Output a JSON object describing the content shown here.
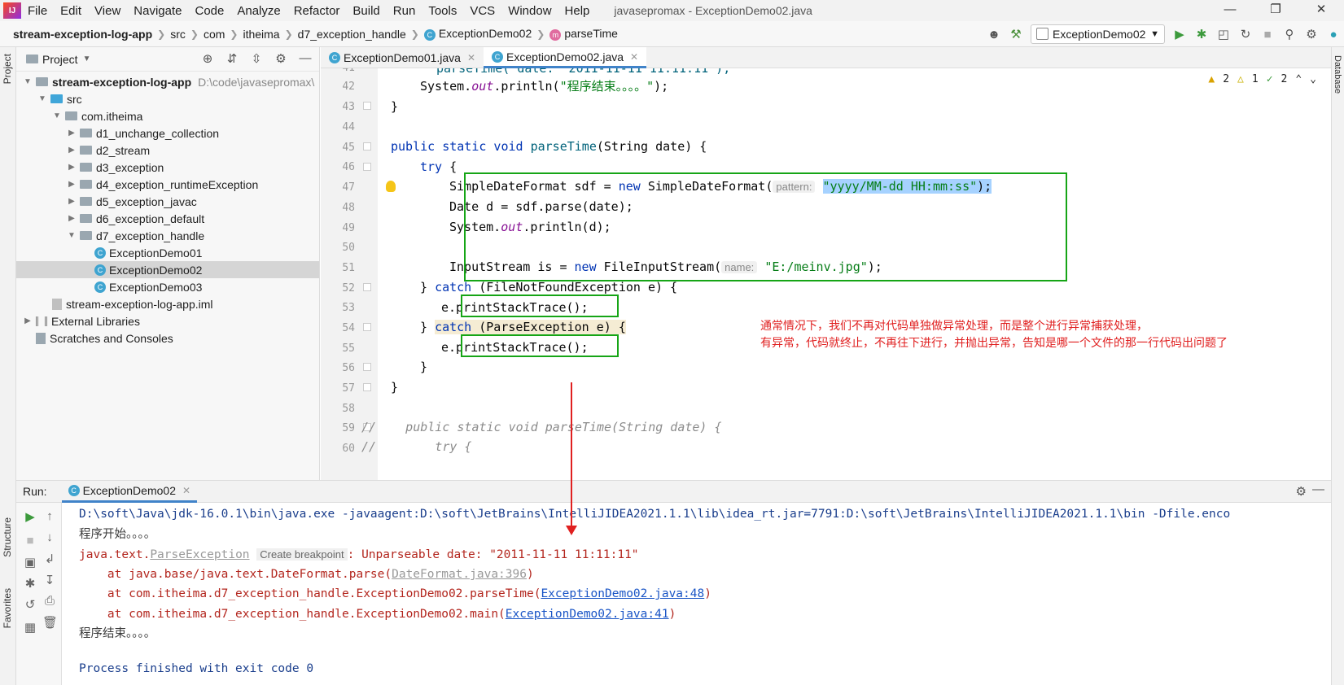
{
  "menubar": {
    "logo": "IJ",
    "items": [
      "File",
      "Edit",
      "View",
      "Navigate",
      "Code",
      "Analyze",
      "Refactor",
      "Build",
      "Run",
      "Tools",
      "VCS",
      "Window",
      "Help"
    ],
    "window_title": "javasepromax - ExceptionDemo02.java"
  },
  "navbar": {
    "crumbs": [
      "stream-exception-log-app",
      "src",
      "com",
      "itheima",
      "d7_exception_handle",
      "ExceptionDemo02",
      "parseTime"
    ],
    "run_config": "ExceptionDemo02"
  },
  "left_strip": {
    "project": "Project",
    "structure": "Structure",
    "favorites": "Favorites"
  },
  "right_strip": {
    "database": "Database"
  },
  "project": {
    "title": "Project",
    "tree": [
      {
        "label": "stream-exception-log-app",
        "hint": "D:\\code\\javasepromax\\",
        "type": "module",
        "expanded": "open"
      },
      {
        "label": "src",
        "type": "src-folder",
        "expanded": "open"
      },
      {
        "label": "com.itheima",
        "type": "folder",
        "expanded": "open"
      },
      {
        "label": "d1_unchange_collection",
        "type": "folder",
        "expanded": "closed"
      },
      {
        "label": "d2_stream",
        "type": "folder",
        "expanded": "closed"
      },
      {
        "label": "d3_exception",
        "type": "folder",
        "expanded": "closed"
      },
      {
        "label": "d4_exception_runtimeException",
        "type": "folder",
        "expanded": "closed"
      },
      {
        "label": "d5_exception_javac",
        "type": "folder",
        "expanded": "closed"
      },
      {
        "label": "d6_exception_default",
        "type": "folder",
        "expanded": "closed"
      },
      {
        "label": "d7_exception_handle",
        "type": "folder",
        "expanded": "open"
      },
      {
        "label": "ExceptionDemo01",
        "type": "class"
      },
      {
        "label": "ExceptionDemo02",
        "type": "class",
        "selected": true
      },
      {
        "label": "ExceptionDemo03",
        "type": "class"
      },
      {
        "label": "stream-exception-log-app.iml",
        "type": "file"
      },
      {
        "label": "External Libraries",
        "type": "lib",
        "expanded": "closed"
      },
      {
        "label": "Scratches and Consoles",
        "type": "scratch"
      }
    ]
  },
  "editor": {
    "tabs": [
      {
        "label": "ExceptionDemo01.java",
        "active": false
      },
      {
        "label": "ExceptionDemo02.java",
        "active": true
      }
    ],
    "inspections": {
      "warnings": "2",
      "weak": "1",
      "ok": "2"
    },
    "line_numbers": [
      "41",
      "42",
      "43",
      "44",
      "45",
      "46",
      "47",
      "48",
      "49",
      "50",
      "51",
      "52",
      "53",
      "54",
      "55",
      "56",
      "57",
      "58",
      "59",
      "60"
    ],
    "code": {
      "l41": "parseTime( date: \"2011-11-11 11:11:11\");",
      "l42_a": "System.",
      "l42_b": "out",
      "l42_c": ".println(",
      "l42_d": "\"程序结束。。。。\"",
      "l42_e": ");",
      "l43": "}",
      "l45_a": "public static void ",
      "l45_b": "parseTime",
      "l45_c": "(String date) {",
      "l46_a": "try",
      "l46_b": " {",
      "l47_a": "SimpleDateFormat sdf = ",
      "l47_b": "new",
      "l47_c": " SimpleDateFormat(",
      "l47_hint": "pattern:",
      "l47_d": "\"yyyy/MM-dd HH:mm:ss\"",
      "l47_e": ");",
      "l48": "Date d = sdf.parse(date);",
      "l49_a": "System.",
      "l49_b": "out",
      "l49_c": ".println(d);",
      "l51_a": "InputStream is = ",
      "l51_b": "new",
      "l51_c": " FileInputStream(",
      "l51_hint": "name:",
      "l51_d": "\"E:/meinv.jpg\"",
      "l51_e": ");",
      "l52_a": "} ",
      "l52_b": "catch",
      "l52_c": " (FileNotFoundException e) {",
      "l53": "e.printStackTrace();",
      "l54_a": "} ",
      "l54_b": "catch",
      "l54_c": " (ParseException e) {",
      "l55": "e.printStackTrace();",
      "l56": "}",
      "l57": "}",
      "l59": "//    public static void parseTime(String date) {",
      "l60": "//        try {"
    },
    "annotation_line1": "通常情况下，我们不再对代码单独做异常处理，而是整个进行异常捕获处理，",
    "annotation_line2": "有异常，代码就终止，不再往下进行，并抛出异常，告知是哪一个文件的那一行代码出问题了"
  },
  "run": {
    "label": "Run:",
    "tab": "ExceptionDemo02",
    "console": {
      "cmd": "D:\\soft\\Java\\jdk-16.0.1\\bin\\java.exe -javaagent:D:\\soft\\JetBrains\\IntelliJIDEA2021.1.1\\lib\\idea_rt.jar=7791:D:\\soft\\JetBrains\\IntelliJIDEA2021.1.1\\bin -Dfile.enco",
      "start": "程序开始。。。。",
      "ex_prefix": "java.text.",
      "ex_class": "ParseException",
      "ex_hint": "Create breakpoint",
      "ex_msg": ": Unparseable date: \"2011-11-11 11:11:11\"",
      "at1_a": "    at java.base/java.text.DateFormat.parse(",
      "at1_link": "DateFormat.java:396",
      "at1_b": ")",
      "at2_a": "    at com.itheima.d7_exception_handle.ExceptionDemo02.parseTime(",
      "at2_link": "ExceptionDemo02.java:48",
      "at2_b": ")",
      "at3_a": "    at com.itheima.d7_exception_handle.ExceptionDemo02.main(",
      "at3_link": "ExceptionDemo02.java:41",
      "at3_b": ")",
      "end": "程序结束。。。。",
      "exit": "Process finished with exit code 0"
    }
  },
  "colors": {
    "accent": "#4083c9",
    "highlight_box": "#16a516",
    "annotation": "#e02020"
  }
}
